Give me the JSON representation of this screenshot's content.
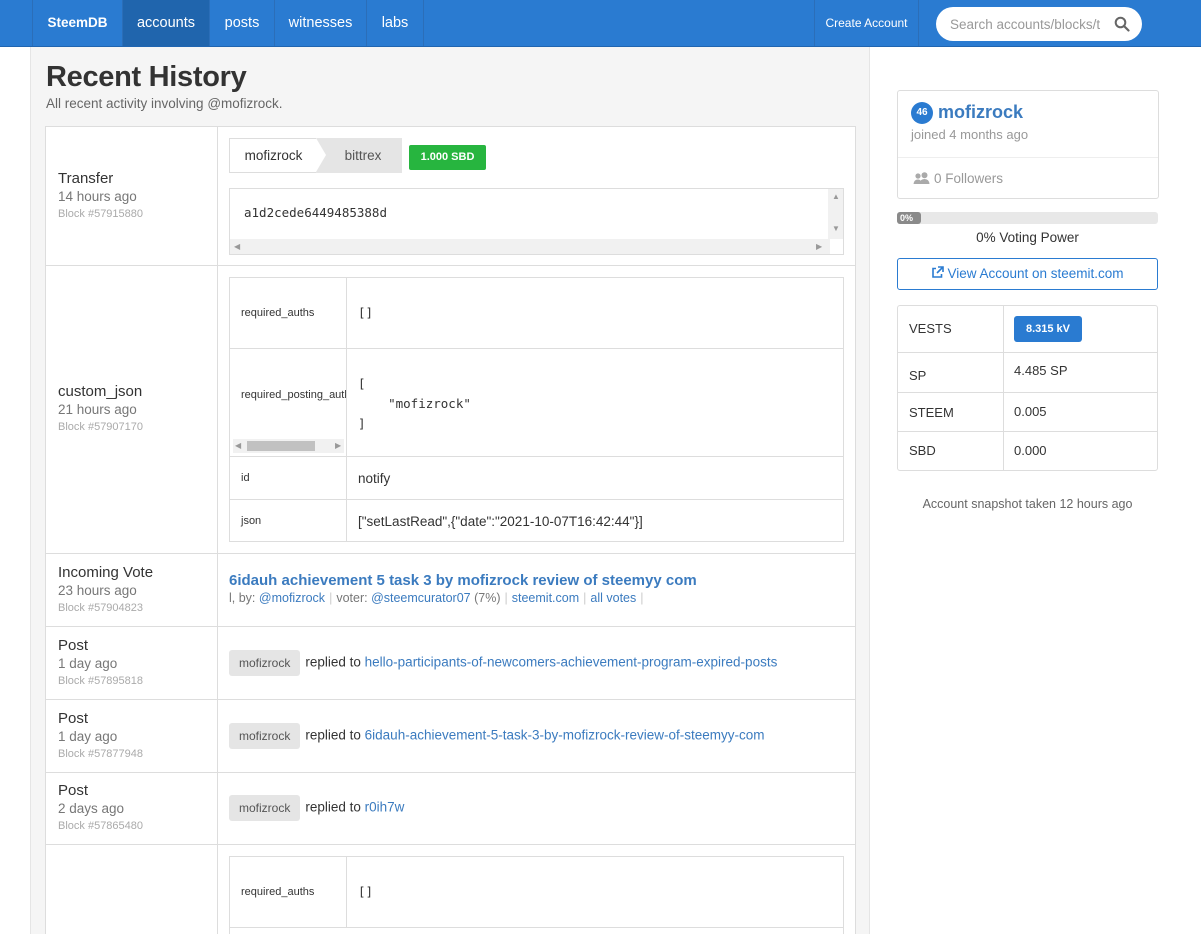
{
  "nav": {
    "brand": "SteemDB",
    "items": [
      "accounts",
      "posts",
      "witnesses",
      "labs"
    ],
    "create_account": "Create Account",
    "search_placeholder": "Search accounts/blocks/t"
  },
  "page": {
    "title": "Recent History",
    "subtitle": "All recent activity involving @mofizrock."
  },
  "history": {
    "transfer": {
      "op": "Transfer",
      "time": "14 hours ago",
      "block": "Block #57915880",
      "from": "mofizrock",
      "to": "bittrex",
      "amount": "1.000 SBD",
      "memo": "a1d2cede6449485388d"
    },
    "custom_json_1": {
      "op": "custom_json",
      "time": "21 hours ago",
      "block": "Block #57907170",
      "rows": [
        {
          "key": "required_auths",
          "value": "[]"
        },
        {
          "key": "required_posting_auths",
          "value": "[\n    \"mofizrock\"\n]"
        },
        {
          "key": "id",
          "value": "notify"
        },
        {
          "key": "json",
          "value": "[\"setLastRead\",{\"date\":\"2021-10-07T16:42:44\"}]"
        }
      ]
    },
    "vote": {
      "op": "Incoming Vote",
      "time": "23 hours ago",
      "block": "Block #57904823",
      "title": "6idauh achievement 5 task 3 by mofizrock review of steemyy com",
      "meta_prefix": "l, by:",
      "author": "@mofizrock",
      "voter_label": "voter:",
      "voter": "@steemcurator07",
      "weight": "(7%)",
      "link1": "steemit.com",
      "link2": "all votes"
    },
    "posts": [
      {
        "op": "Post",
        "time": "1 day ago",
        "block": "Block #57895818",
        "author": "mofizrock",
        "action": "replied to",
        "target": "hello-participants-of-newcomers-achievement-program-expired-posts"
      },
      {
        "op": "Post",
        "time": "1 day ago",
        "block": "Block #57877948",
        "author": "mofizrock",
        "action": "replied to",
        "target": "6idauh-achievement-5-task-3-by-mofizrock-review-of-steemyy-com"
      },
      {
        "op": "Post",
        "time": "2 days ago",
        "block": "Block #57865480",
        "author": "mofizrock",
        "action": "replied to",
        "target": "r0ih7w"
      }
    ],
    "custom_json_2": {
      "rows": [
        {
          "key": "required_auths",
          "value": "[]"
        }
      ]
    }
  },
  "account": {
    "reputation": "46",
    "name": "mofizrock",
    "joined": "joined 4 months ago",
    "followers": "0 Followers",
    "voting_power_pct": 0,
    "voting_power_badge": "0%",
    "voting_power_label": "0% Voting Power",
    "view_button": "View Account on steemit.com",
    "balances": [
      {
        "key": "VESTS",
        "value": "8.315 kV"
      },
      {
        "key": "SP",
        "value": "4.485 SP"
      },
      {
        "key": "STEEM",
        "value": "0.005"
      },
      {
        "key": "SBD",
        "value": "0.000"
      }
    ],
    "snapshot": "Account snapshot taken 12 hours ago"
  },
  "colors": {
    "nav": "#2a7bd1",
    "link": "#3b7bbf",
    "amount_badge": "#27b53f"
  }
}
